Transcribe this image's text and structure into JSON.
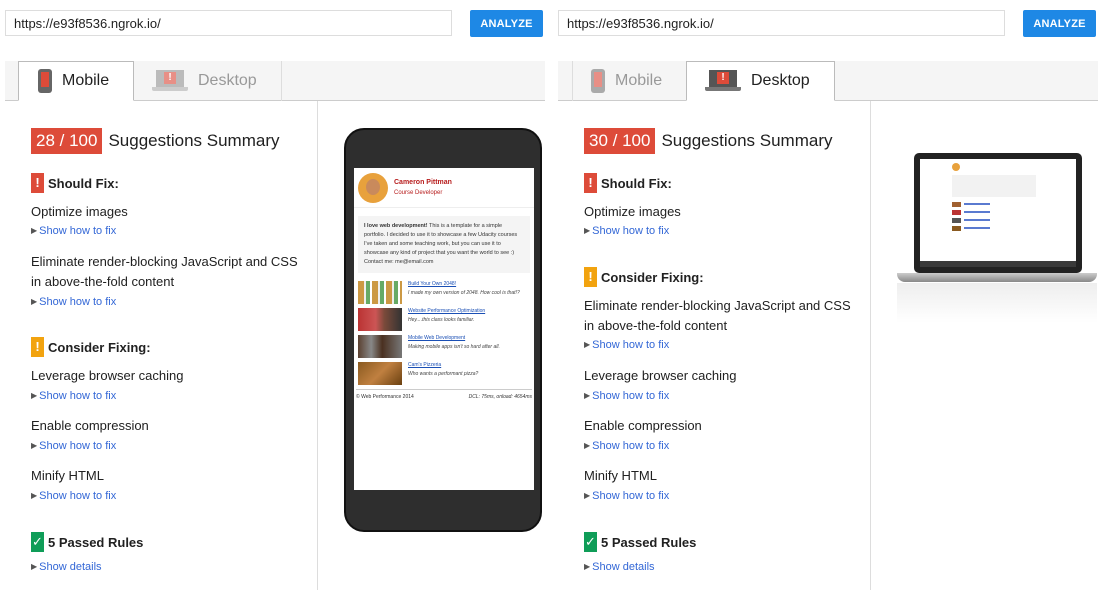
{
  "panels": [
    {
      "url": "https://e93f8536.ngrok.io/",
      "analyze_label": "ANALYZE",
      "tabs": {
        "mobile": "Mobile",
        "desktop": "Desktop"
      },
      "score": "28 / 100",
      "score_label": "Suggestions Summary",
      "should_fix": "Should Fix:",
      "consider_fixing": "Consider Fixing:",
      "passed": "5 Passed Rules",
      "rules": [
        "Optimize images",
        "Eliminate render-blocking JavaScript and CSS in above-the-fold content",
        "Leverage browser caching",
        "Enable compression",
        "Minify HTML"
      ],
      "show_fix": "Show how to fix",
      "show_details": "Show details"
    },
    {
      "url": "https://e93f8536.ngrok.io/",
      "analyze_label": "ANALYZE",
      "tabs": {
        "mobile": "Mobile",
        "desktop": "Desktop"
      },
      "score": "30 / 100",
      "score_label": "Suggestions Summary",
      "should_fix": "Should Fix:",
      "consider_fixing": "Consider Fixing:",
      "passed": "5 Passed Rules",
      "rules": [
        "Optimize images",
        "Eliminate render-blocking JavaScript and CSS in above-the-fold content",
        "Leverage browser caching",
        "Enable compression",
        "Minify HTML"
      ],
      "show_fix": "Show how to fix",
      "show_details": "Show details"
    }
  ],
  "phone_preview": {
    "name": "Cameron Pittman",
    "role": "Course Developer",
    "bio_bold": "I love web development!",
    "bio": "This is a template for a simple portfolio. I decided to use it to showcase a few Udacity courses I've taken and some teaching work, but you can use it to showcase any kind of project that you want the world to see :)",
    "contact": "Contact me: me@email.com",
    "projects": [
      {
        "title": "Build Your Own 2048!",
        "desc": "I made my own version of 2048. How cool is that!?"
      },
      {
        "title": "Website Performance Optimization",
        "desc": "Hey....this class looks familiar."
      },
      {
        "title": "Mobile Web Development",
        "desc": "Making mobile apps isn't so hard after all."
      },
      {
        "title": "Cam's Pizzeria",
        "desc": "Who wants a performant pizza?"
      }
    ],
    "footer_left": "© Web Performance 2014",
    "footer_right": "DCL: 75ms, onload: 4654ms"
  },
  "colors": {
    "score_red": "#dd4b39",
    "should_fix_red": "#dd4b39",
    "consider_orange": "#f2a30f",
    "passed_green": "#0f9d58",
    "link_blue": "#3367d6",
    "analyze_blue": "#1e88e5"
  },
  "icons": {
    "should_fix": "exclamation-icon",
    "consider": "exclamation-icon",
    "passed": "checkmark-icon",
    "expand": "triangle-right-icon"
  }
}
